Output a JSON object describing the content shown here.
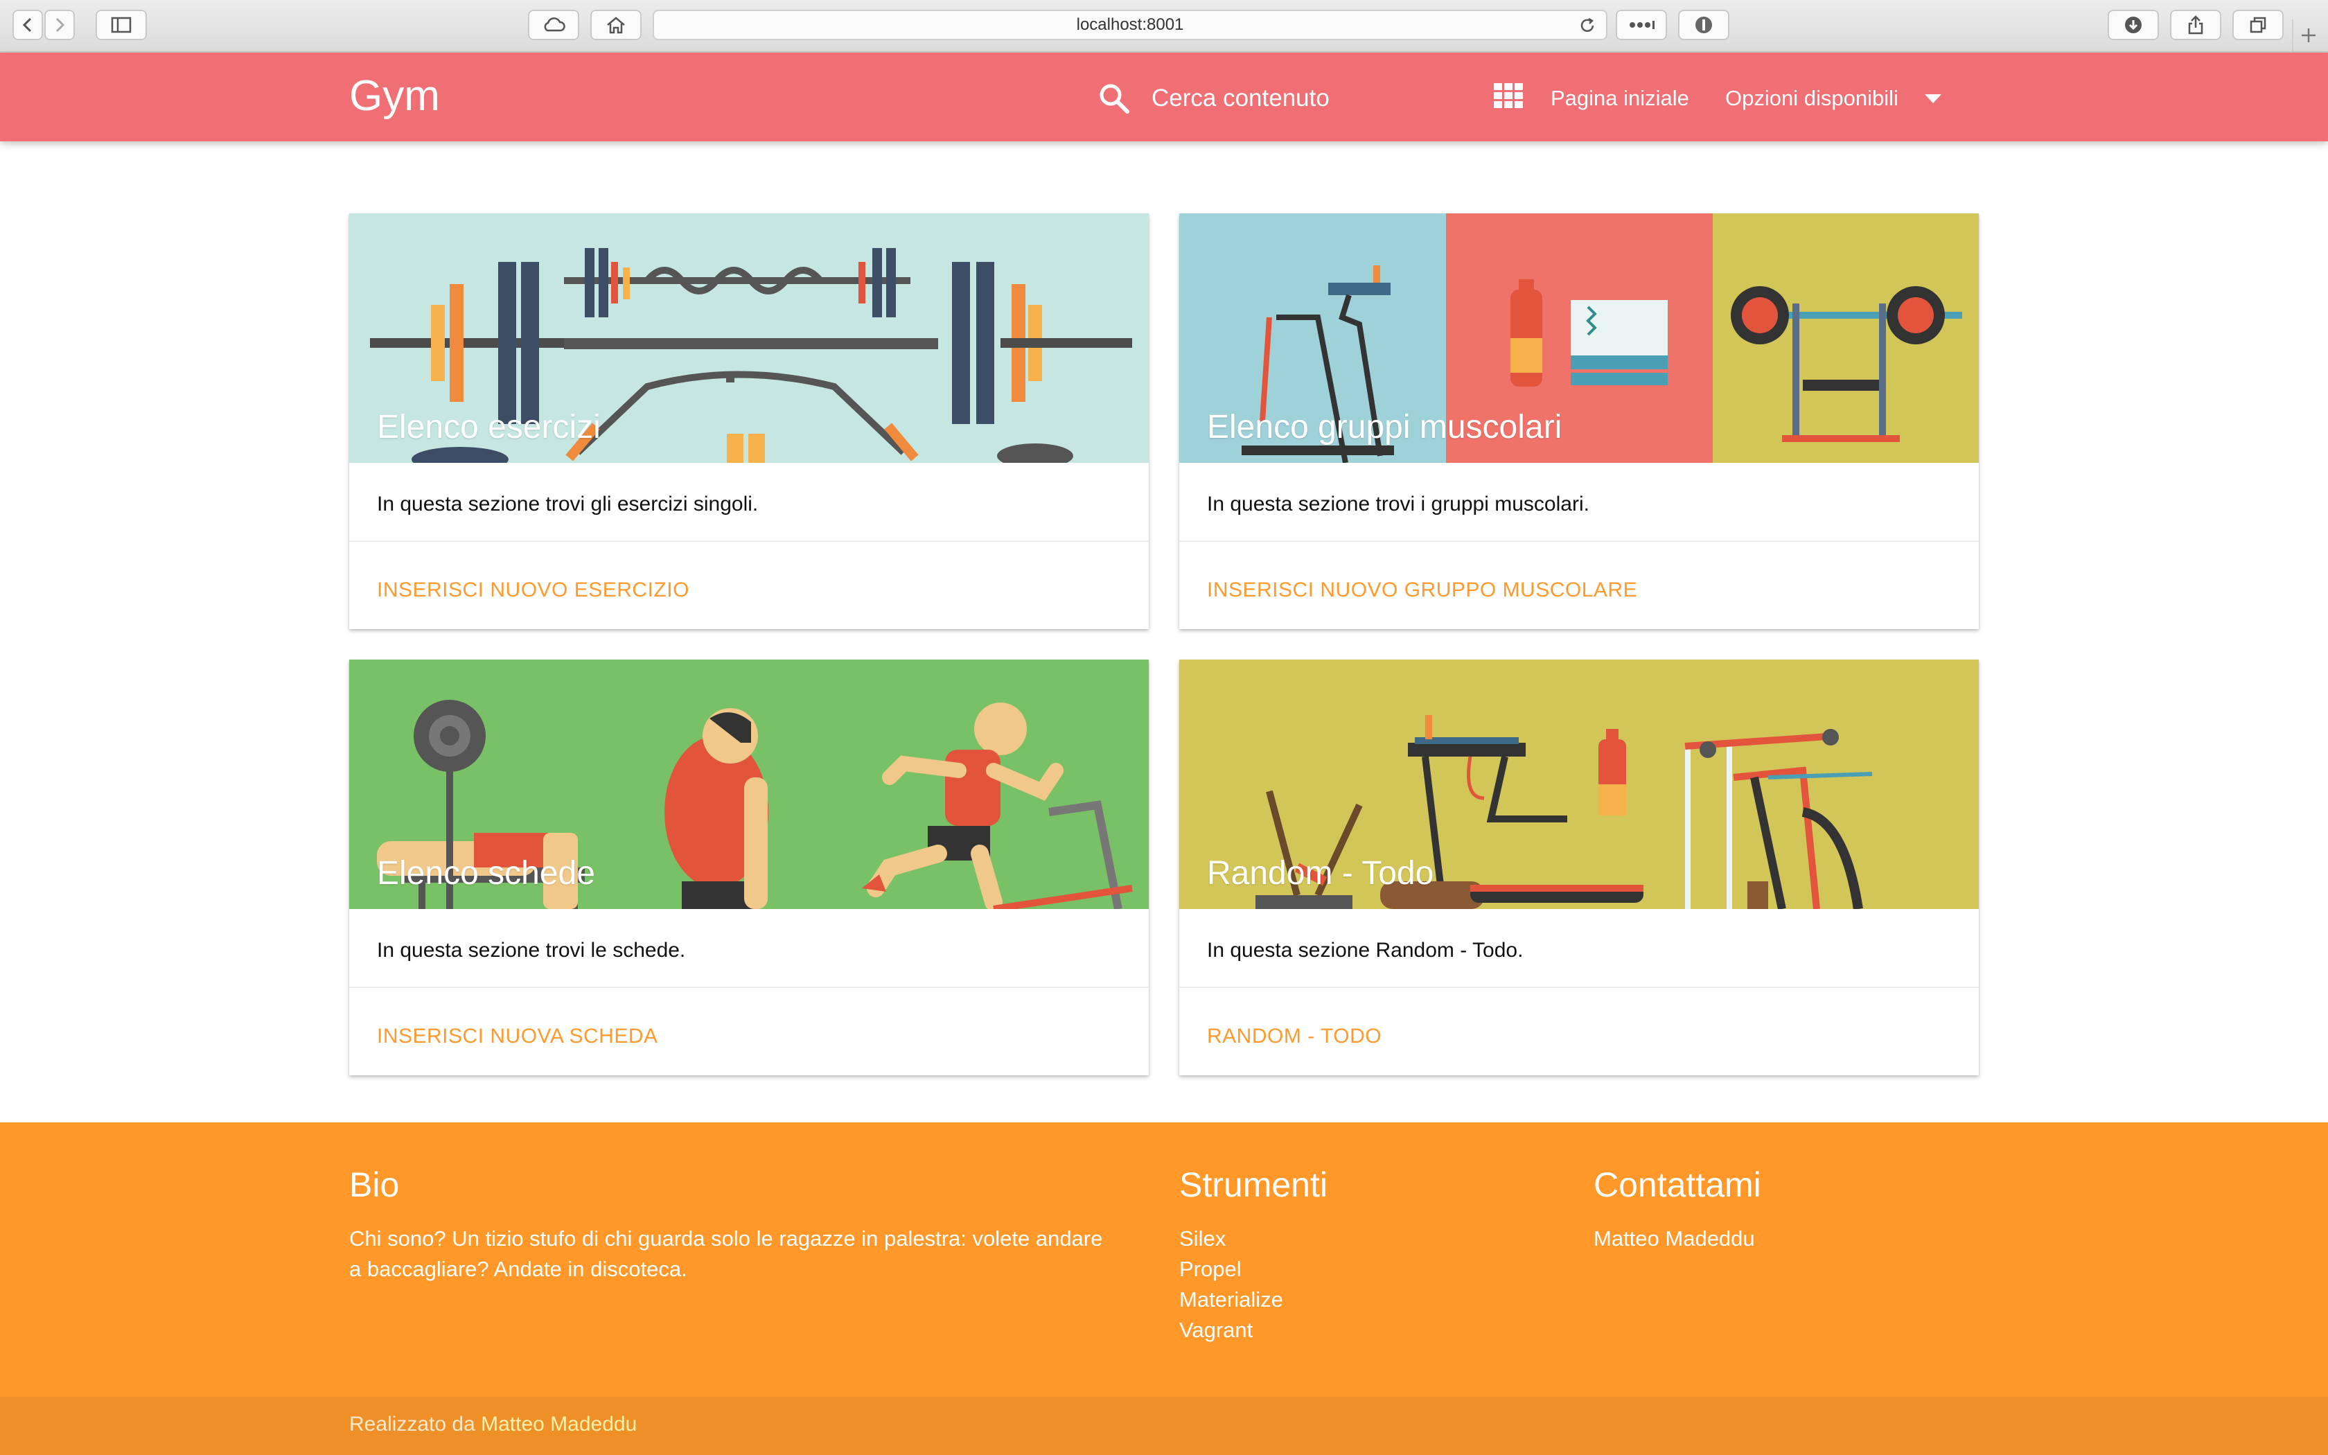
{
  "browser": {
    "url": "localhost:8001"
  },
  "navbar": {
    "brand": "Gym",
    "search_label": "Cerca contenuto",
    "home_label": "Pagina iniziale",
    "options_label": "Opzioni disponibili"
  },
  "cards": [
    {
      "title": "Elenco esercizi",
      "description": "In questa sezione trovi gli esercizi singoli.",
      "action": "INSERISCI NUOVO ESERCIZIO"
    },
    {
      "title": "Elenco gruppi muscolari",
      "description": "In questa sezione trovi i gruppi muscolari.",
      "action": "INSERISCI NUOVO GRUPPO MUSCOLARE"
    },
    {
      "title": "Elenco schede",
      "description": "In questa sezione trovi le schede.",
      "action": "INSERISCI NUOVA SCHEDA"
    },
    {
      "title": "Random - Todo",
      "description": "In questa sezione Random - Todo.",
      "action": "RANDOM - TODO"
    }
  ],
  "footer": {
    "bio_title": "Bio",
    "bio_text": "Chi sono? Un tizio stufo di chi guarda solo le ragazze in palestra: volete andare a baccagliare? Andate in discoteca.",
    "tools_title": "Strumenti",
    "tools": [
      "Silex",
      "Propel",
      "Materialize",
      "Vagrant"
    ],
    "contact_title": "Contattami",
    "contact_name": "Matteo Madeddu",
    "copyright_prefix": "Realizzato da",
    "copyright_author": "Matteo Madeddu"
  },
  "colors": {
    "navbar": "#ef6f74",
    "accent": "#ff9a2e",
    "footer": "#ff9829"
  }
}
